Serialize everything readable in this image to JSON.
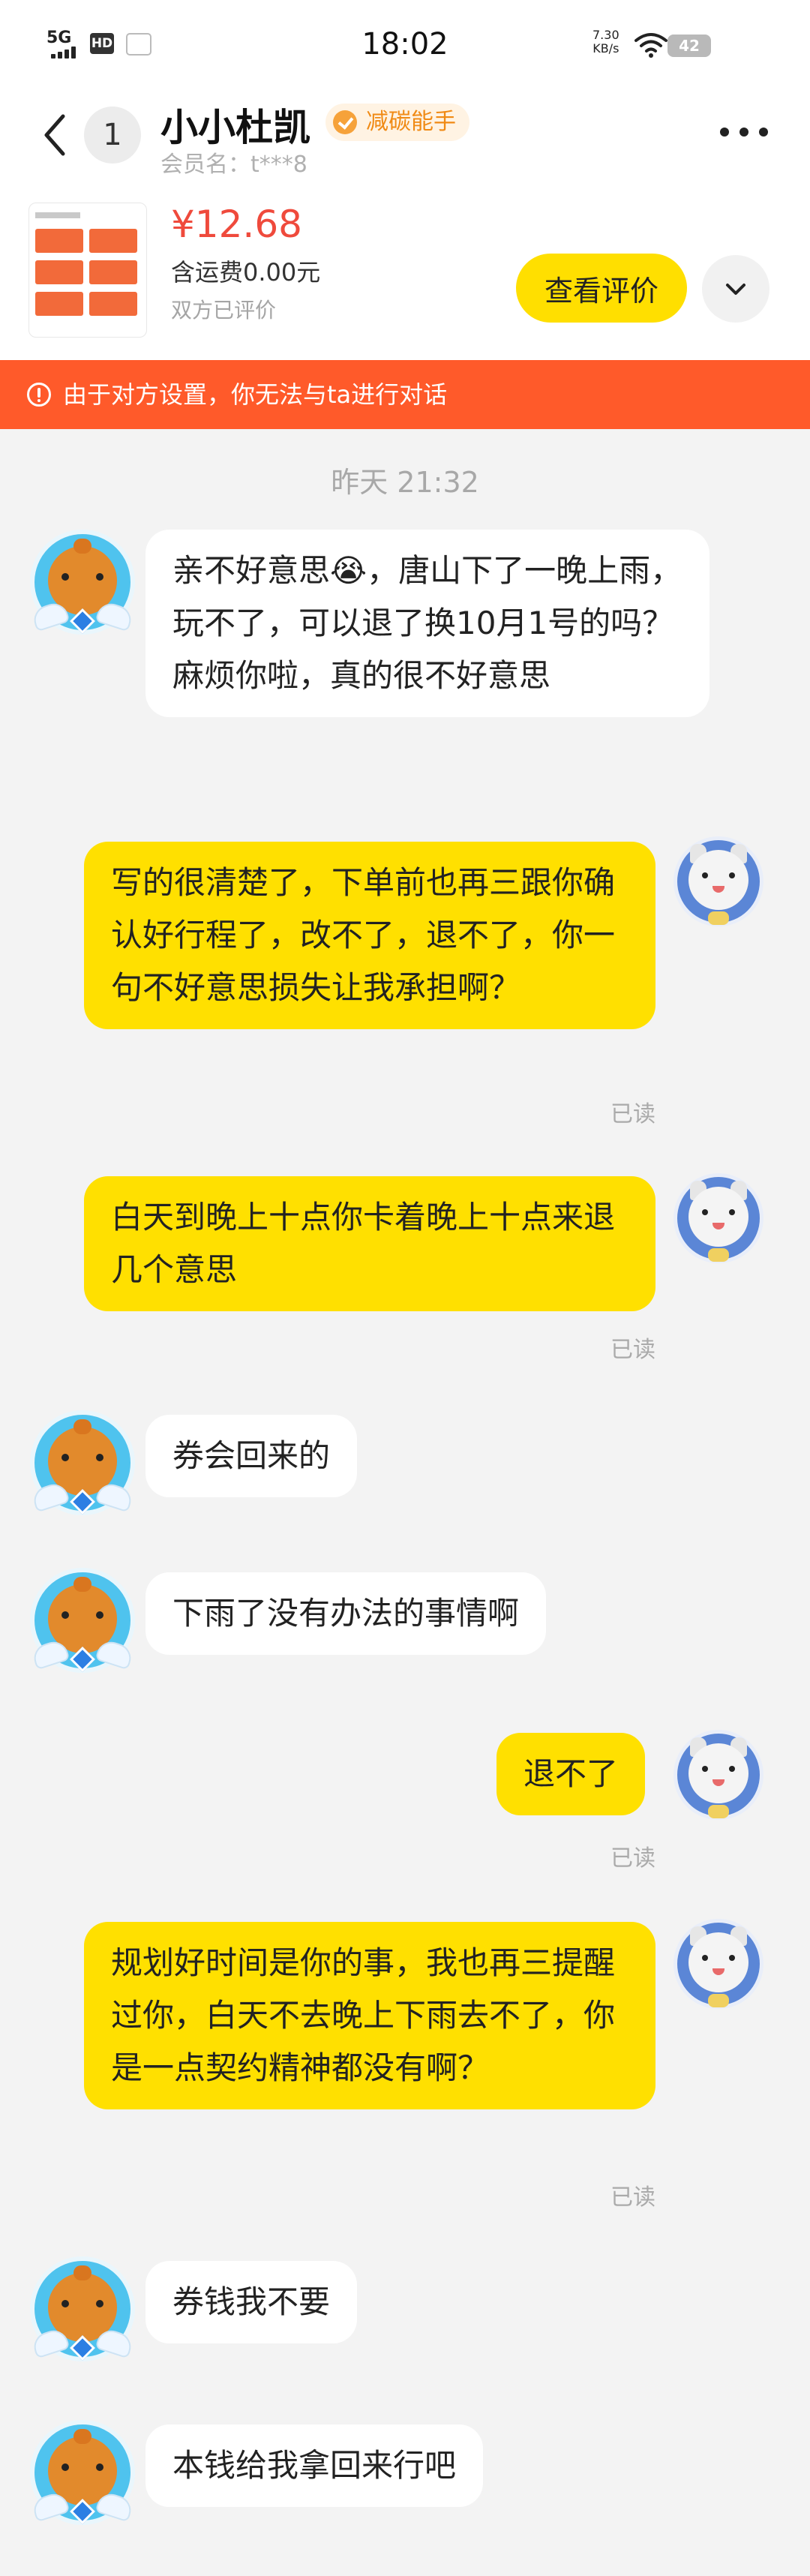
{
  "status_bar": {
    "network": "5G",
    "hd": "HD",
    "time": "18:02",
    "speed_value": "7.30",
    "speed_unit": "KB/s",
    "battery": "42"
  },
  "header": {
    "unread_count": "1",
    "nickname": "小小杜凯",
    "badge": "减碳能手",
    "member_name": "会员名：t***8"
  },
  "order": {
    "price": "¥12.68",
    "shipping": "含运费0.00元",
    "review_status": "双方已评价",
    "view_review_label": "查看评价"
  },
  "banner": {
    "text": "由于对方设置，你无法与ta进行对话"
  },
  "chat": {
    "timestamp": "昨天 21:32",
    "messages": [
      {
        "from": "other",
        "text": "亲不好意思😭，唐山下了一晚上雨，玩不了，可以退了换10月1号的吗？麻烦你啦，真的很不好意思"
      },
      {
        "from": "me",
        "text": "写的很清楚了，下单前也再三跟你确认好行程了，改不了，退不了，你一句不好意思损失让我承担啊？",
        "status": "已读"
      },
      {
        "from": "me",
        "text": "白天到晚上十点你卡着晚上十点来退几个意思",
        "status": "已读"
      },
      {
        "from": "other",
        "text": "券会回来的"
      },
      {
        "from": "other",
        "text": "下雨了没有办法的事情啊"
      },
      {
        "from": "me",
        "text": "退不了",
        "status": "已读"
      },
      {
        "from": "me",
        "text": "规划好时间是你的事，我也再三提醒过你，白天不去晚上下雨去不了，你是一点契约精神都没有啊？",
        "status": "已读"
      },
      {
        "from": "other",
        "text": "券钱我不要"
      },
      {
        "from": "other",
        "text": "本钱给我拿回来行吧"
      }
    ]
  },
  "colors": {
    "my_bubble": "#ffe000",
    "their_bubble": "#ffffff",
    "banner": "#ff5a2a",
    "price": "#ef4a3c",
    "badge_text": "#f08a14"
  }
}
